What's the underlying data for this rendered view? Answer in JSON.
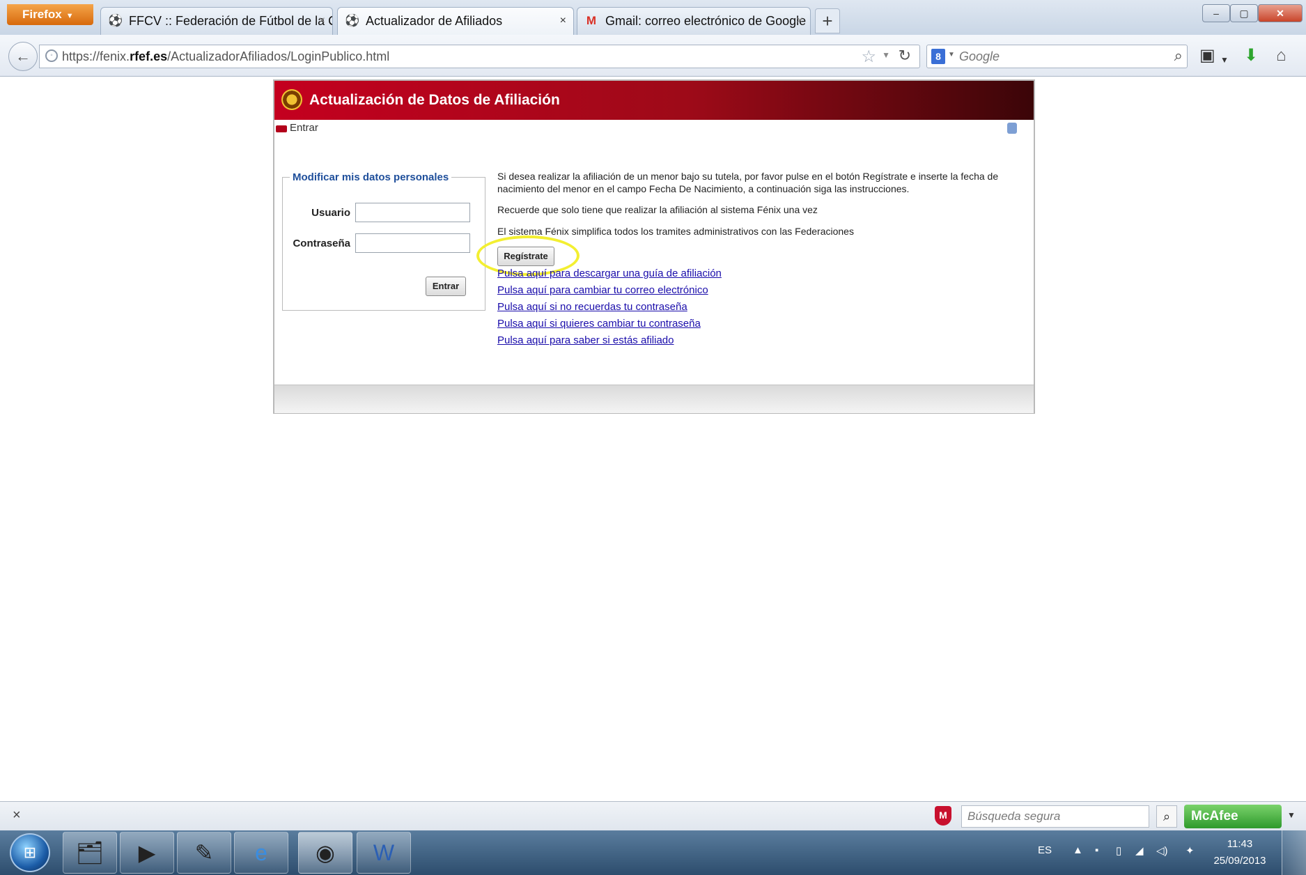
{
  "browser": {
    "menu_button": "Firefox",
    "tabs": [
      {
        "title": "FFCV :: Federación de Fútbol de la Co...",
        "icon": "crest-icon"
      },
      {
        "title": "Actualizador de Afiliados",
        "icon": "crest-icon"
      },
      {
        "title": "Gmail: correo electrónico de Google",
        "icon": "gmail-icon"
      }
    ],
    "new_tab": "+",
    "url_prefix": "https://fenix.",
    "url_domain": "rfef.es",
    "url_path": "/ActualizadorAfiliados/LoginPublico.html",
    "search_engine": "Google",
    "search_placeholder": "Google"
  },
  "app": {
    "title": "Actualización de Datos de Afiliación",
    "breadcrumb": "Entrar",
    "accent_color": "#c4001f"
  },
  "login": {
    "legend": "Modificar mis datos personales",
    "user_label": "Usuario",
    "user_value": "",
    "password_label": "Contraseña",
    "password_value": "",
    "submit_label": "Entrar"
  },
  "info": {
    "p1": "Si desea realizar la afiliación de un menor bajo su tutela, por favor pulse en el botón Regístrate e inserte la fecha de nacimiento del menor en el campo Fecha De Nacimiento, a continuación siga las instrucciones.",
    "p2": "Recuerde que solo tiene que realizar la afiliación al sistema Fénix una vez",
    "p3": "El sistema Fénix simplifica todos los tramites administrativos con las Federaciones",
    "register_label": "Regístrate",
    "links": [
      "Pulsa aquí para descargar una guía de afiliación",
      "Pulsa aquí para cambiar tu correo electrónico",
      "Pulsa aquí si no recuerdas tu contraseña",
      "Pulsa aquí si quieres cambiar tu contraseña",
      "Pulsa aquí para saber si estás afiliado"
    ]
  },
  "addon_bar": {
    "close": "×",
    "secure_search_placeholder": "Búsqueda segura",
    "mcafee_label": "McAfee"
  },
  "taskbar": {
    "language": "ES",
    "time": "11:43",
    "date": "25/09/2013"
  }
}
